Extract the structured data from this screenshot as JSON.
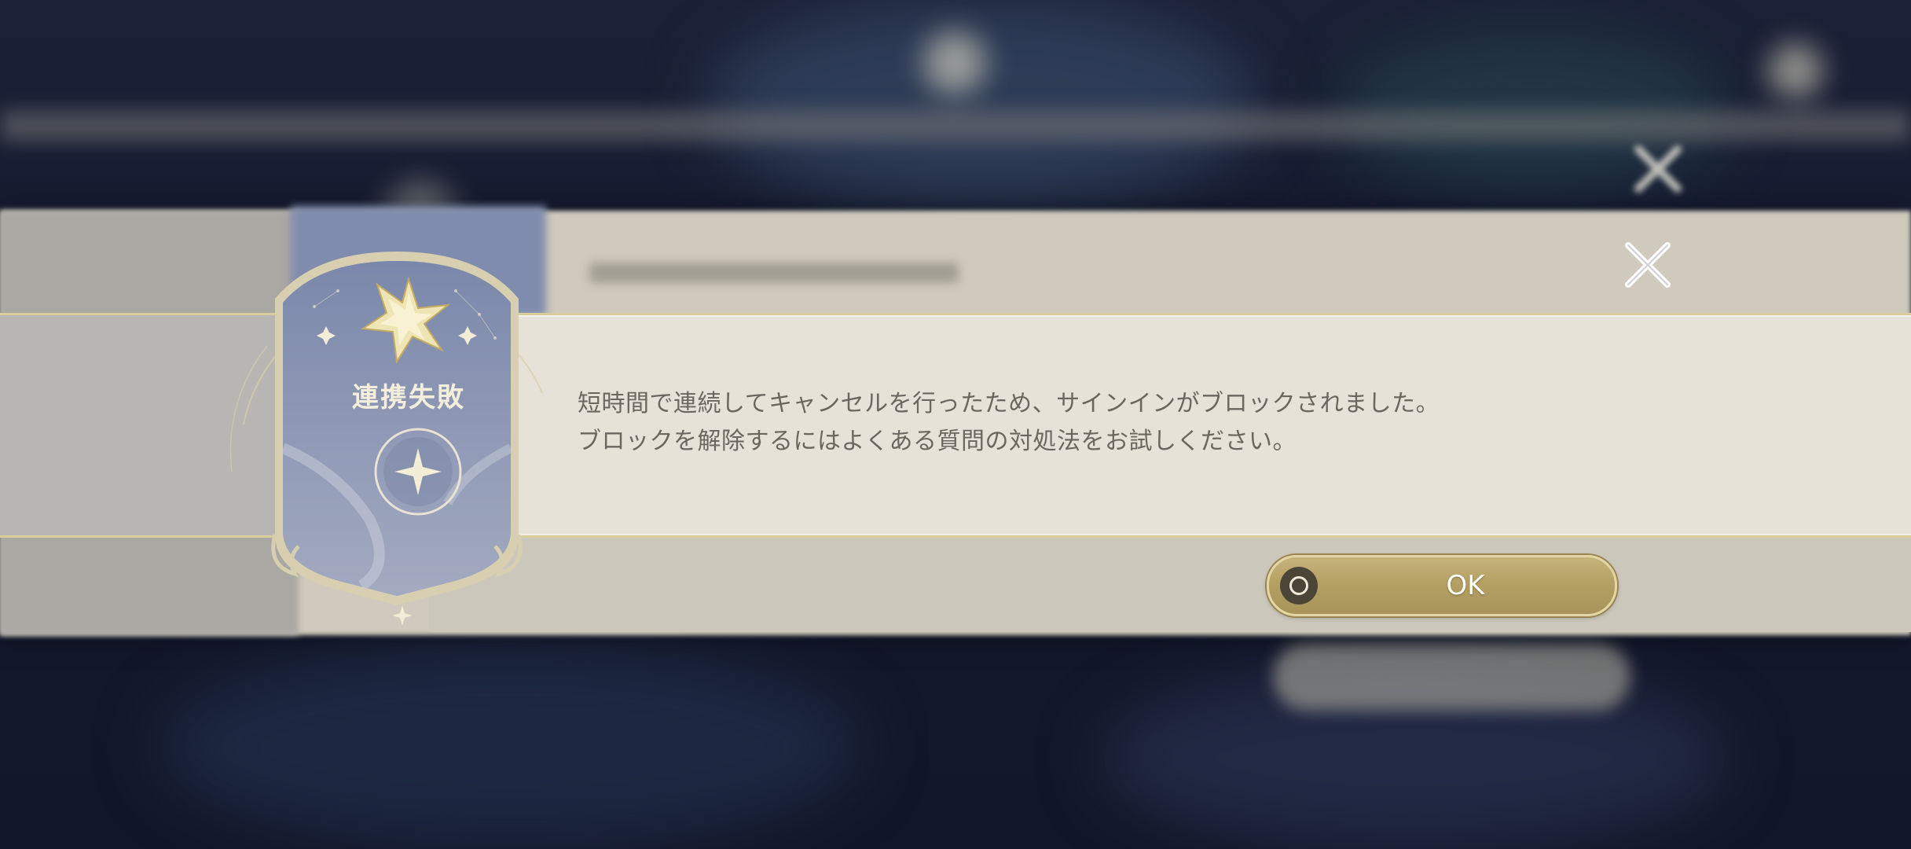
{
  "dialog": {
    "badge_title": "連携失敗",
    "message_lines": [
      "短時間で連続してキャンセルを行ったため、サインインがブロックされました。",
      "ブロックを解除するにはよくある質問の対処法をお試しください。"
    ],
    "ok_label": "OK",
    "close_icon": "close-icon",
    "ok_icon": "circle-button-icon",
    "badge_icon": "star-compass-icon"
  },
  "colors": {
    "panel": "#e7e2d7",
    "panel_border": "#d9cd9c",
    "text": "#6a6660",
    "badge": "#7f8cad",
    "button_gold": "#b49f62",
    "background": "#141a2e"
  }
}
